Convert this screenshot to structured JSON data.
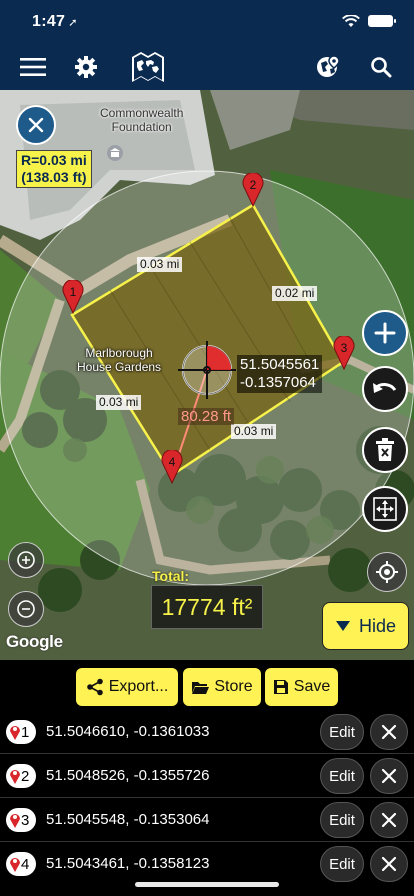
{
  "status": {
    "time": "1:47"
  },
  "header": {
    "logo": "world-map-logo",
    "icons": [
      "menu-icon",
      "gear-icon",
      "globe-location-icon",
      "search-icon"
    ]
  },
  "map": {
    "radius_label_mi": "R=0.03 mi",
    "radius_label_ft": "(138.03 ft)",
    "places": {
      "commonwealth": "Commonwealth\nFoundation",
      "marlborough": "Marlborough\nHouse Gardens"
    },
    "distances": {
      "top": "0.03 mi",
      "right": "0.02 mi",
      "left": "0.03 mi",
      "bottom": "0.03 mi"
    },
    "center_coords": {
      "lat": "51.5045561",
      "lon": "-0.1357064"
    },
    "center_distance": "80.28 ft",
    "markers": [
      "1",
      "2",
      "3",
      "4"
    ],
    "total_label": "Total:",
    "total_value": "17774 ft²",
    "hide_label": "Hide",
    "attribution": "Google",
    "colors": {
      "polygon_fill": "#7a6a1a",
      "polygon_edge": "#f7f24a",
      "marker": "#d9262a",
      "accent": "#1e5a8a"
    }
  },
  "actions": {
    "export": "Export...",
    "store": "Store",
    "save": "Save"
  },
  "points": [
    {
      "n": "1",
      "coords": "51.5046610, -0.1361033",
      "edit": "Edit"
    },
    {
      "n": "2",
      "coords": "51.5048526, -0.1355726",
      "edit": "Edit"
    },
    {
      "n": "3",
      "coords": "51.5045548, -0.1353064",
      "edit": "Edit"
    },
    {
      "n": "4",
      "coords": "51.5043461, -0.1358123",
      "edit": "Edit"
    }
  ]
}
